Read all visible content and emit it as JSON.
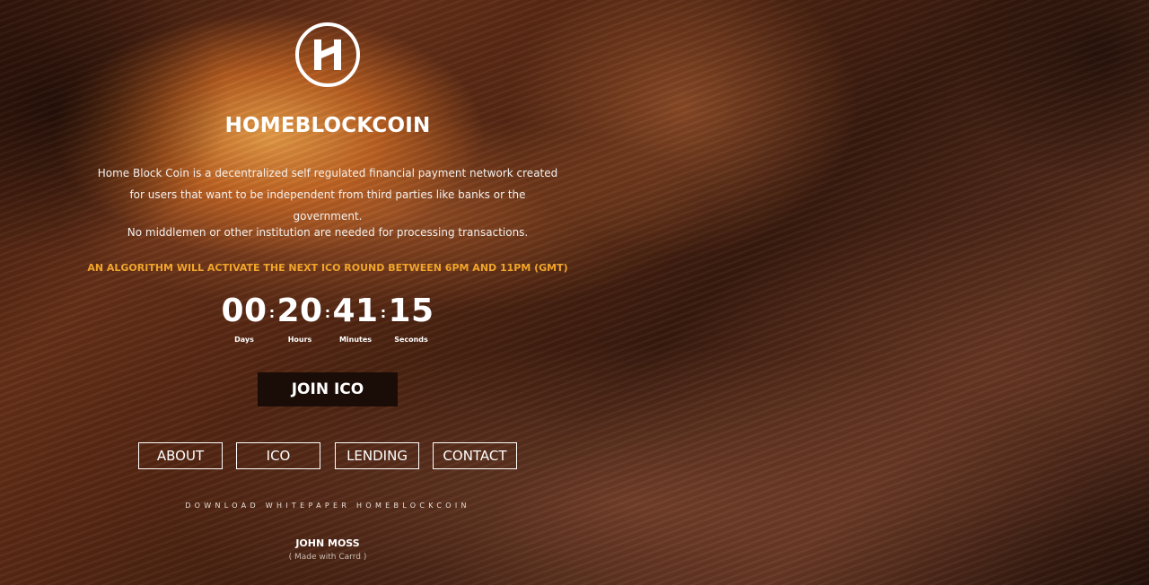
{
  "brand": {
    "name": "HOMEBLOCKCOIN",
    "logo_icon": "hb-monogram-icon"
  },
  "intro": {
    "paragraph1": "Home Block Coin is a decentralized self regulated financial payment network created for users that want to be independent from third parties like banks or the government.",
    "paragraph2": "No middlemen or other institution are needed for processing transactions."
  },
  "notice": {
    "text": "AN ALGORITHM WILL ACTIVATE THE NEXT ICO ROUND BETWEEN 6PM AND 11PM (GMT)",
    "color": "#f1a52b"
  },
  "countdown": {
    "units": [
      {
        "value": "00",
        "label": "Days"
      },
      {
        "value": "20",
        "label": "Hours"
      },
      {
        "value": "41",
        "label": "Minutes"
      },
      {
        "value": "15",
        "label": "Seconds"
      }
    ],
    "separator": ":"
  },
  "cta": {
    "join_label": "JOIN ICO"
  },
  "nav": {
    "about": "ABOUT",
    "ico": "ICO",
    "lending": "LENDING",
    "contact": "CONTACT"
  },
  "footer": {
    "whitepaper_link": "DOWNLOAD WHITEPAPER HOMEBLOCKCOIN",
    "author": "JOHN MOSS",
    "made_with": "( Made with Carrd )"
  }
}
